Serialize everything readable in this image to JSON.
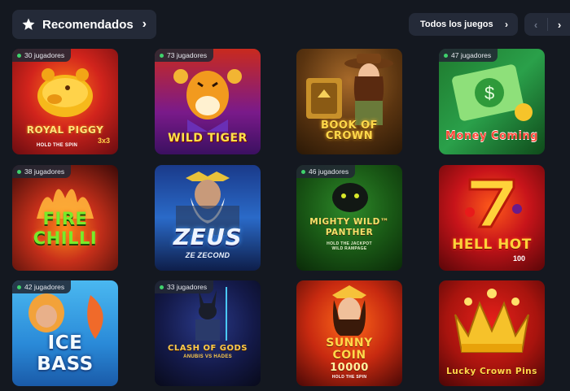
{
  "header": {
    "title": "Recomendados",
    "all_games_label": "Todos los juegos"
  },
  "icons": {
    "star": "star-icon",
    "chevron": "chevron-right-icon",
    "prev": "chevron-left-icon",
    "next": "chevron-right-icon"
  },
  "games": [
    {
      "players": "30 jugadores",
      "title": "ROYAL PIGGY",
      "extra": "3x3",
      "subtitle": "HOLD THE SPIN"
    },
    {
      "players": "73 jugadores",
      "title": "WILD TIGER"
    },
    {
      "title": "BOOK OF CROWN"
    },
    {
      "players": "47 jugadores",
      "title": "Money Coming"
    },
    {
      "players": "38 jugadores",
      "title": "FIRE CHILLI"
    },
    {
      "title": "ZEUS",
      "subtitle": "ZE ZECOND"
    },
    {
      "players": "46 jugadores",
      "title": "MIGHTY WILD™ PANTHER",
      "subtitle": "HOLD THE JACKPOT WILD RAMPAGE"
    },
    {
      "title": "HELL HOT",
      "extra": "100"
    },
    {
      "players": "42 jugadores",
      "title": "ICE BASS"
    },
    {
      "players": "33 jugadores",
      "title": "CLASH OF GODS",
      "subtitle": "ANUBIS VS HADES"
    },
    {
      "title": "SUNNY COIN",
      "extra": "10000",
      "subtitle": "HOLD THE SPIN"
    },
    {
      "title": "Lucky Crown Pins"
    }
  ]
}
